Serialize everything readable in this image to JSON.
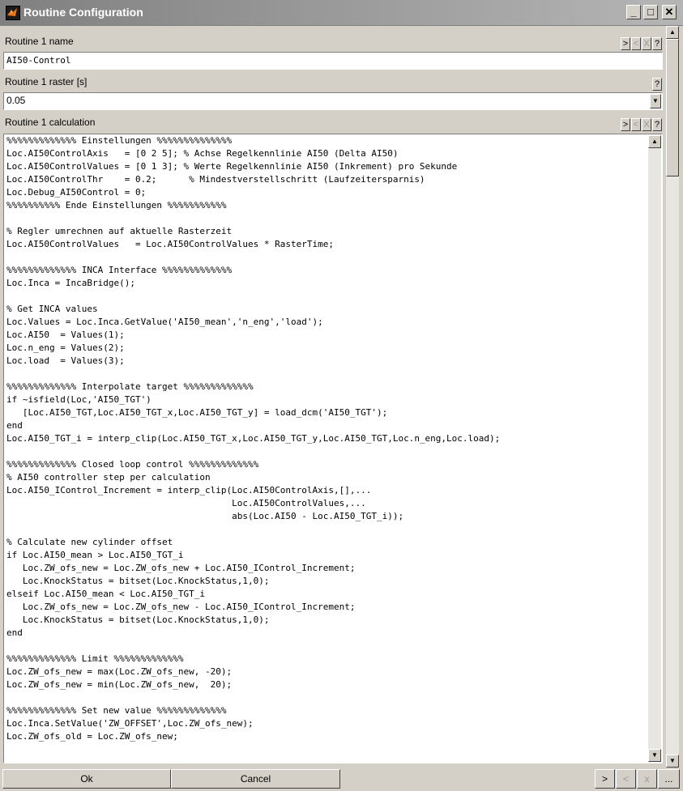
{
  "window": {
    "title": "Routine Configuration",
    "minimize": "_",
    "maximize": "□",
    "close": "✕"
  },
  "name_section": {
    "label": "Routine 1 name",
    "value": "AI50-Control",
    "buttons": [
      ">",
      "<",
      "X",
      "?"
    ]
  },
  "raster_section": {
    "label": "Routine 1 raster [s]",
    "value": "0.05",
    "help": "?",
    "dropdown": "▼"
  },
  "calc_section": {
    "label": "Routine 1 calculation",
    "buttons": [
      ">",
      "<",
      "X",
      "?"
    ],
    "code": "%%%%%%%%%%%%% Einstellungen %%%%%%%%%%%%%%\nLoc.AI50ControlAxis   = [0 2 5]; % Achse Regelkennlinie AI50 (Delta AI50)\nLoc.AI50ControlValues = [0 1 3]; % Werte Regelkennlinie AI50 (Inkrement) pro Sekunde\nLoc.AI50ControlThr    = 0.2;      % Mindestverstellschritt (Laufzeitersparnis)\nLoc.Debug_AI50Control = 0;\n%%%%%%%%%% Ende Einstellungen %%%%%%%%%%%\n\n% Regler umrechnen auf aktuelle Rasterzeit\nLoc.AI50ControlValues   = Loc.AI50ControlValues * RasterTime;\n\n%%%%%%%%%%%%% INCA Interface %%%%%%%%%%%%%\nLoc.Inca = IncaBridge();\n\n% Get INCA values\nLoc.Values = Loc.Inca.GetValue('AI50_mean','n_eng','load');\nLoc.AI50  = Values(1);\nLoc.n_eng = Values(2);\nLoc.load  = Values(3);\n\n%%%%%%%%%%%%% Interpolate target %%%%%%%%%%%%%\nif ~isfield(Loc,'AI50_TGT')\n   [Loc.AI50_TGT,Loc.AI50_TGT_x,Loc.AI50_TGT_y] = load_dcm('AI50_TGT');\nend\nLoc.AI50_TGT_i = interp_clip(Loc.AI50_TGT_x,Loc.AI50_TGT_y,Loc.AI50_TGT,Loc.n_eng,Loc.load);\n\n%%%%%%%%%%%%% Closed loop control %%%%%%%%%%%%%\n% AI50 controller step per calculation\nLoc.AI50_IControl_Increment = interp_clip(Loc.AI50ControlAxis,[],...\n                                          Loc.AI50ControlValues,...\n                                          abs(Loc.AI50 - Loc.AI50_TGT_i));\n\n% Calculate new cylinder offset\nif Loc.AI50_mean > Loc.AI50_TGT_i\n   Loc.ZW_ofs_new = Loc.ZW_ofs_new + Loc.AI50_IControl_Increment;\n   Loc.KnockStatus = bitset(Loc.KnockStatus,1,0);\nelseif Loc.AI50_mean < Loc.AI50_TGT_i\n   Loc.ZW_ofs_new = Loc.ZW_ofs_new - Loc.AI50_IControl_Increment;\n   Loc.KnockStatus = bitset(Loc.KnockStatus,1,0);\nend\n\n%%%%%%%%%%%%% Limit %%%%%%%%%%%%%\nLoc.ZW_ofs_new = max(Loc.ZW_ofs_new, -20);\nLoc.ZW_ofs_new = min(Loc.ZW_ofs_new,  20);\n\n%%%%%%%%%%%%% Set new value %%%%%%%%%%%%%\nLoc.Inca.SetValue('ZW_OFFSET',Loc.ZW_ofs_new);\nLoc.ZW_ofs_old = Loc.ZW_ofs_new;"
  },
  "scroll": {
    "up": "▲",
    "down": "▼"
  },
  "footer": {
    "ok": "Ok",
    "cancel": "Cancel",
    "next": ">",
    "prev": "<",
    "delete": "x",
    "more": "..."
  },
  "colors": {
    "face": "#d4d0c8",
    "title_start": "#808080",
    "title_end": "#b5b5b5"
  }
}
